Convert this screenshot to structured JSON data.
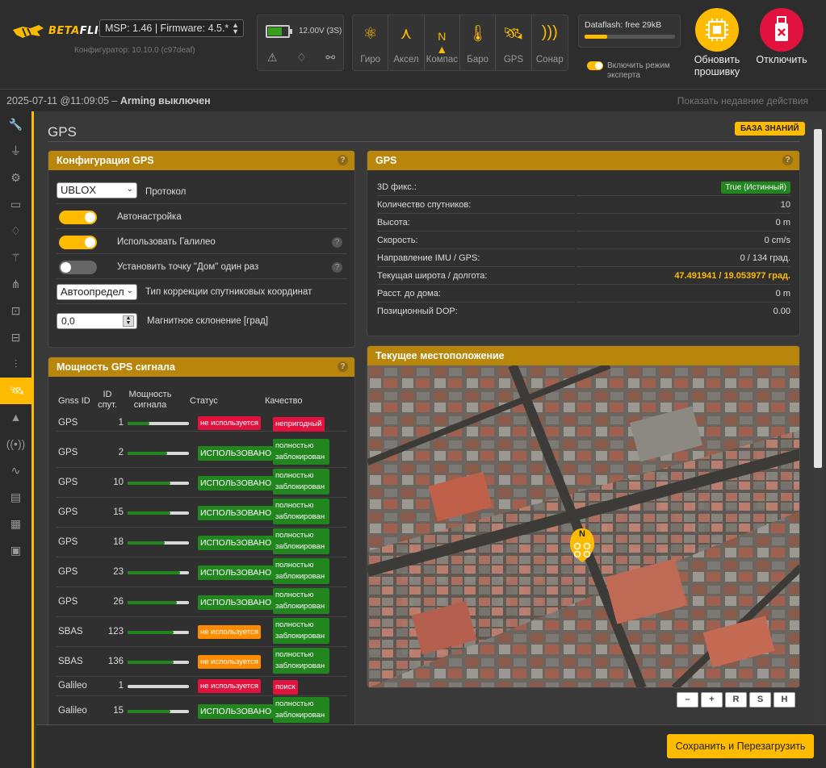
{
  "header": {
    "logo_text": "BETA",
    "logo_text2": "FLIGHT",
    "msp_firmware": "MSP: 1.46 | Firmware: 4.5.*",
    "configurator": "Конфигуратор: 10.10.0 (c97deaf)",
    "battery_voltage": "12.00V (3S)",
    "sensors": [
      {
        "label": "Гиро",
        "icon": "gyro-icon"
      },
      {
        "label": "Аксел",
        "icon": "accel-icon"
      },
      {
        "label": "Компас",
        "icon": "compass-icon"
      },
      {
        "label": "Баро",
        "icon": "baro-icon"
      },
      {
        "label": "GPS",
        "icon": "gps-icon"
      },
      {
        "label": "Сонар",
        "icon": "sonar-icon"
      }
    ],
    "dataflash": "Dataflash: free 29kB",
    "dataflash_used_fraction": 0.25,
    "expert_mode": "Включить режим эксперта",
    "update_firmware": "Обновить прошивку",
    "disconnect": "Отключить"
  },
  "statusline": {
    "datetime": "2025-07-11 @11:09:05 –",
    "arming": "Arming выключен",
    "recent_actions": "Показать недавние действия"
  },
  "page": {
    "title": "GPS",
    "wiki": "БАЗА ЗНАНИЙ"
  },
  "config": {
    "title": "Конфигурация GPS",
    "protocol_value": "UBLOX",
    "protocol_label": "Протокол",
    "autoconfig_label": "Автонастройка",
    "galileo_label": "Использовать Галилео",
    "home_once_label": "Установить точку \"Дом\" один раз",
    "sbas_value": "Автоопредел",
    "sbas_label": "Тип коррекции спутниковых координат",
    "magdecl_value": "0,0",
    "magdecl_label": "Магнитное склонение [град]",
    "help": "?"
  },
  "gps": {
    "title": "GPS",
    "rows": [
      {
        "k": "3D фикс.:",
        "v": "True (Истинный)"
      },
      {
        "k": "Количество спутников:",
        "v": "10"
      },
      {
        "k": "Высота:",
        "v": "0 m"
      },
      {
        "k": "Скорость:",
        "v": "0 cm/s"
      },
      {
        "k": "Направление IMU / GPS:",
        "v": "0 / 134 град."
      },
      {
        "k": "Текущая широта / долгота:",
        "v": "47.491941 / 19.053977 град."
      },
      {
        "k": "Расст. до дома:",
        "v": "0 m"
      },
      {
        "k": "Позиционный DOP:",
        "v": "0.00"
      }
    ]
  },
  "signal": {
    "title": "Мощность GPS сигнала",
    "col_gnss": "Gnss ID",
    "col_id1": "ID",
    "col_id2": "спут.",
    "col_strength1": "Мощность",
    "col_strength2": "сигнала",
    "col_status": "Статус",
    "col_quality": "Качество",
    "rows": [
      {
        "gnss": "GPS",
        "id": "1",
        "strength": 0.35,
        "status": "не используется",
        "status_type": "red",
        "quality": "непригодный",
        "q_type": "red"
      },
      {
        "gnss": "GPS",
        "id": "2",
        "strength": 0.65,
        "status": "ИСПОЛЬЗОВАНО",
        "status_type": "green",
        "quality": "полностью заблокирован",
        "q_type": "green"
      },
      {
        "gnss": "GPS",
        "id": "10",
        "strength": 0.7,
        "status": "ИСПОЛЬЗОВАНО",
        "status_type": "green",
        "quality": "полностью заблокирован",
        "q_type": "green"
      },
      {
        "gnss": "GPS",
        "id": "15",
        "strength": 0.7,
        "status": "ИСПОЛЬЗОВАНО",
        "status_type": "green",
        "quality": "полностью заблокирован",
        "q_type": "green"
      },
      {
        "gnss": "GPS",
        "id": "18",
        "strength": 0.6,
        "status": "ИСПОЛЬЗОВАНО",
        "status_type": "green",
        "quality": "полностью заблокирован",
        "q_type": "green"
      },
      {
        "gnss": "GPS",
        "id": "23",
        "strength": 0.85,
        "status": "ИСПОЛЬЗОВАНО",
        "status_type": "green",
        "quality": "полностью заблокирован",
        "q_type": "green"
      },
      {
        "gnss": "GPS",
        "id": "26",
        "strength": 0.8,
        "status": "ИСПОЛЬЗОВАНО",
        "status_type": "green",
        "quality": "полностью заблокирован",
        "q_type": "green"
      },
      {
        "gnss": "SBAS",
        "id": "123",
        "strength": 0.75,
        "status": "не используется",
        "status_type": "orange",
        "quality": "полностью заблокирован",
        "q_type": "green"
      },
      {
        "gnss": "SBAS",
        "id": "136",
        "strength": 0.75,
        "status": "не используется",
        "status_type": "orange",
        "quality": "полностью заблокирован",
        "q_type": "green"
      },
      {
        "gnss": "Galileo",
        "id": "1",
        "strength": 0.0,
        "status": "не используется",
        "status_type": "red",
        "quality": "поиск",
        "q_type": "red"
      },
      {
        "gnss": "Galileo",
        "id": "15",
        "strength": 0.7,
        "status": "ИСПОЛЬЗОВАНО",
        "status_type": "green",
        "quality": "полностью заблокирован",
        "q_type": "green"
      }
    ]
  },
  "map": {
    "title": "Текущее местоположение",
    "marker_label": "N",
    "controls": [
      "–",
      "+",
      "R",
      "S",
      "H"
    ]
  },
  "footer": {
    "save_reboot": "Сохранить и Перезагрузить"
  },
  "colors": {
    "accent": "#ffbb00",
    "green": "#20861d",
    "red": "#e2123f",
    "orange": "#ff8c00"
  }
}
